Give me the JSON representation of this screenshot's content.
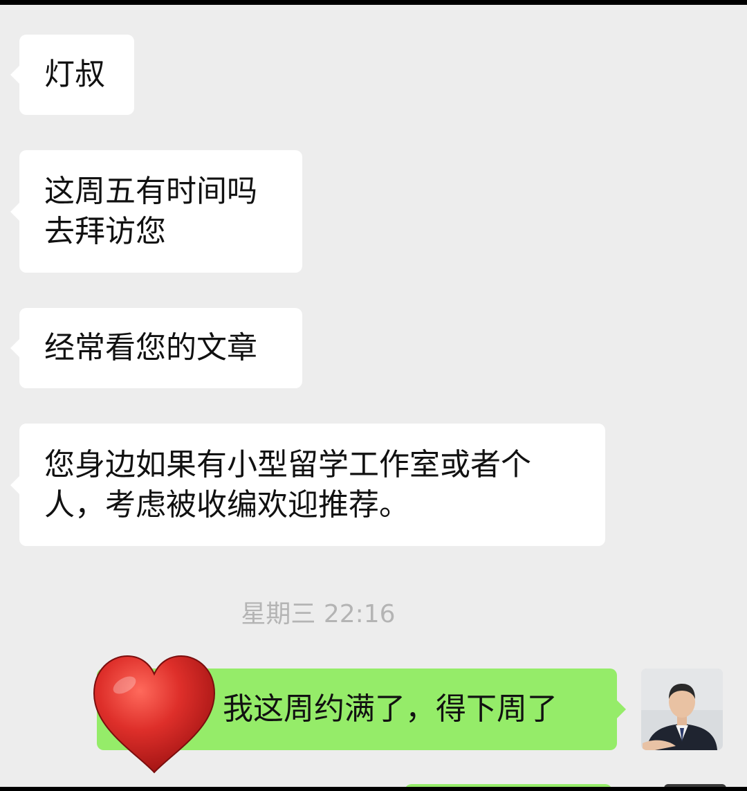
{
  "chat": {
    "messages": [
      {
        "sender": "other",
        "lines": [
          "灯叔"
        ]
      },
      {
        "sender": "other",
        "lines": [
          "这周五有时间吗",
          "去拜访您"
        ]
      },
      {
        "sender": "other",
        "lines": [
          "经常看您的文章"
        ]
      },
      {
        "sender": "other",
        "lines": [
          "您身边如果有小型留学工作室或者个",
          "人，考虑被收编欢迎推荐。"
        ]
      },
      {
        "sender": "me",
        "text": "我这周约满了，得下周了"
      }
    ],
    "timestamp": "星期三 22:16"
  },
  "colors": {
    "background": "#ededed",
    "incoming_bubble": "#ffffff",
    "outgoing_bubble": "#95ec69",
    "timestamp": "#b4b4b4",
    "heart": "#d42a2a"
  },
  "icons": {
    "heart": "red-heart-emoji",
    "avatar": "user-avatar-man-in-suit"
  }
}
